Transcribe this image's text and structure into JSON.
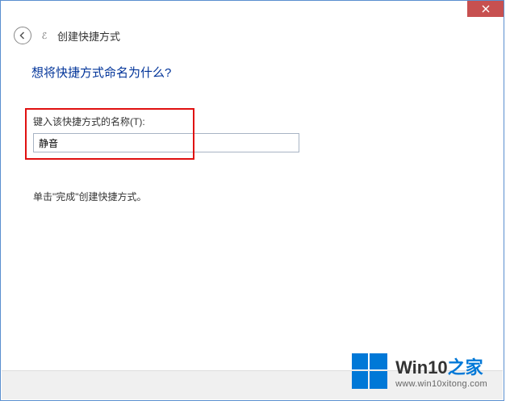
{
  "window": {
    "title": "创建快捷方式"
  },
  "page": {
    "heading": "想将快捷方式命名为什么?",
    "field_label": "键入该快捷方式的名称(T):",
    "input_value": "静音",
    "hint": "单击\"完成\"创建快捷方式。"
  },
  "watermark": {
    "brand_prefix": "Win10",
    "brand_suffix": "之家",
    "url": "www.win10xitong.com"
  }
}
